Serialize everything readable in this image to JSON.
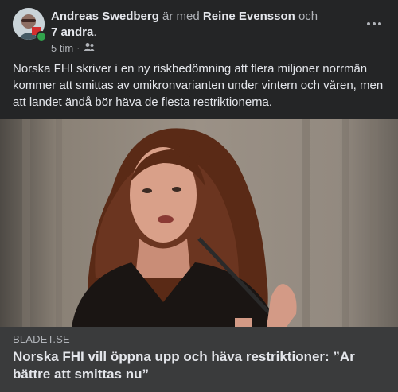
{
  "post": {
    "author": "Andreas Swedberg",
    "with_text": "är med",
    "tagged_person": "Reine Evensson",
    "and_text": "och",
    "others": "7 andra",
    "period": ".",
    "time": "5 tim",
    "separator": "·",
    "audience_icon": "friends-icon",
    "more_icon": "more-options-icon",
    "body": "Norska FHI skriver i en ny riskbedömning att flera miljoner norrmän kommer att smittas av omikronvarianten under vintern och våren, men att landet ändå bör häva de flesta restriktionerna."
  },
  "link": {
    "domain": "BLADET.SE",
    "headline": "Norska FHI vill öppna upp och häva restriktioner: ”Ar bättre att smittas nu”"
  },
  "colors": {
    "background": "#242526",
    "link_box": "#3a3b3c",
    "online": "#31a24c"
  }
}
